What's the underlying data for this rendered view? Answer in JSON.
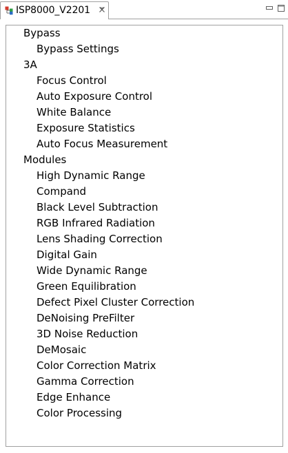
{
  "tab": {
    "title": "ISP8000_V2201"
  },
  "view_buttons": {
    "minimize_icon": "minimize-icon",
    "maximize_icon": "maximize-icon"
  },
  "tree": [
    {
      "label": "Bypass",
      "level": 0,
      "name": "tree-group-bypass",
      "children": [
        {
          "label": "Bypass Settings",
          "level": 1,
          "name": "tree-item-bypass-settings"
        }
      ]
    },
    {
      "label": "3A",
      "level": 0,
      "name": "tree-group-3a",
      "children": [
        {
          "label": "Focus Control",
          "level": 1,
          "name": "tree-item-focus-control"
        },
        {
          "label": "Auto Exposure Control",
          "level": 1,
          "name": "tree-item-auto-exposure-control"
        },
        {
          "label": "White Balance",
          "level": 1,
          "name": "tree-item-white-balance"
        },
        {
          "label": "Exposure Statistics",
          "level": 1,
          "name": "tree-item-exposure-statistics"
        },
        {
          "label": "Auto Focus Measurement",
          "level": 1,
          "name": "tree-item-auto-focus-measurement"
        }
      ]
    },
    {
      "label": "Modules",
      "level": 0,
      "name": "tree-group-modules",
      "children": [
        {
          "label": "High Dynamic Range",
          "level": 1,
          "name": "tree-item-high-dynamic-range"
        },
        {
          "label": "Compand",
          "level": 1,
          "name": "tree-item-compand"
        },
        {
          "label": "Black Level Subtraction",
          "level": 1,
          "name": "tree-item-black-level-subtraction"
        },
        {
          "label": "RGB Infrared Radiation",
          "level": 1,
          "name": "tree-item-rgb-infrared-radiation"
        },
        {
          "label": "Lens Shading Correction",
          "level": 1,
          "name": "tree-item-lens-shading-correction"
        },
        {
          "label": "Digital Gain",
          "level": 1,
          "name": "tree-item-digital-gain"
        },
        {
          "label": "Wide Dynamic Range",
          "level": 1,
          "name": "tree-item-wide-dynamic-range"
        },
        {
          "label": "Green Equilibration",
          "level": 1,
          "name": "tree-item-green-equilibration"
        },
        {
          "label": "Defect Pixel Cluster Correction",
          "level": 1,
          "name": "tree-item-defect-pixel-cluster-correction"
        },
        {
          "label": "DeNoising PreFilter",
          "level": 1,
          "name": "tree-item-denoising-prefilter"
        },
        {
          "label": "3D Noise Reduction",
          "level": 1,
          "name": "tree-item-3d-noise-reduction"
        },
        {
          "label": "DeMosaic",
          "level": 1,
          "name": "tree-item-demosaic"
        },
        {
          "label": "Color Correction Matrix",
          "level": 1,
          "name": "tree-item-color-correction-matrix"
        },
        {
          "label": "Gamma Correction",
          "level": 1,
          "name": "tree-item-gamma-correction"
        },
        {
          "label": "Edge Enhance",
          "level": 1,
          "name": "tree-item-edge-enhance"
        },
        {
          "label": "Color Processing",
          "level": 1,
          "name": "tree-item-color-processing"
        }
      ]
    }
  ]
}
